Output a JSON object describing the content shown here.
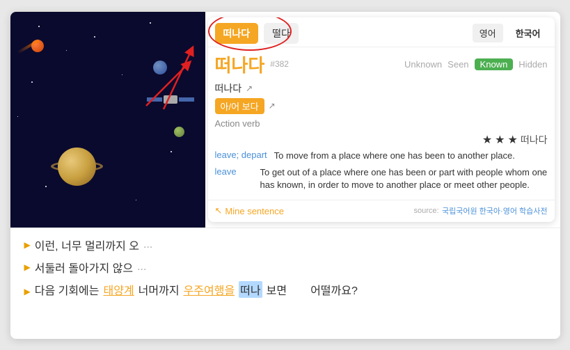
{
  "popup": {
    "btn_떠나다": "떠나다",
    "btn_떨다": "떨다",
    "lang_english": "영어",
    "lang_korean": "한국어",
    "word_main": "떠나다",
    "word_number": "#382",
    "status_unknown": "Unknown",
    "status_seen": "Seen",
    "status_known": "Known",
    "status_hidden": "Hidden",
    "subword": "떠나다",
    "conjugate": "아/어 보다",
    "pos": "Action verb",
    "definition1_term": "leave; depart",
    "definition1_text": "To move from a place where one has been to another place.",
    "definition2_term": "leave",
    "definition2_text": "To get out of a place where one has been or part with people whom one has known, in order to move to another place or meet other people.",
    "mine_sentence": "Mine sentence",
    "source_label": "source:",
    "source_link": "국립국어원 한국아·영어 학습사전",
    "stars_word": "떠나다"
  },
  "sentences": [
    {
      "prefix": "►",
      "text_before": "이런, 너무 멀리까지 오",
      "ellipsis": "..."
    },
    {
      "prefix": "►",
      "text_before": "서둘러 돌아가지 않으",
      "ellipsis": "..."
    },
    {
      "prefix": "►",
      "parts": [
        "다음 기회에는 태양계 너머까지 우주여행을",
        "떠나",
        "보면"
      ],
      "suffix": "어떨까요?"
    }
  ]
}
